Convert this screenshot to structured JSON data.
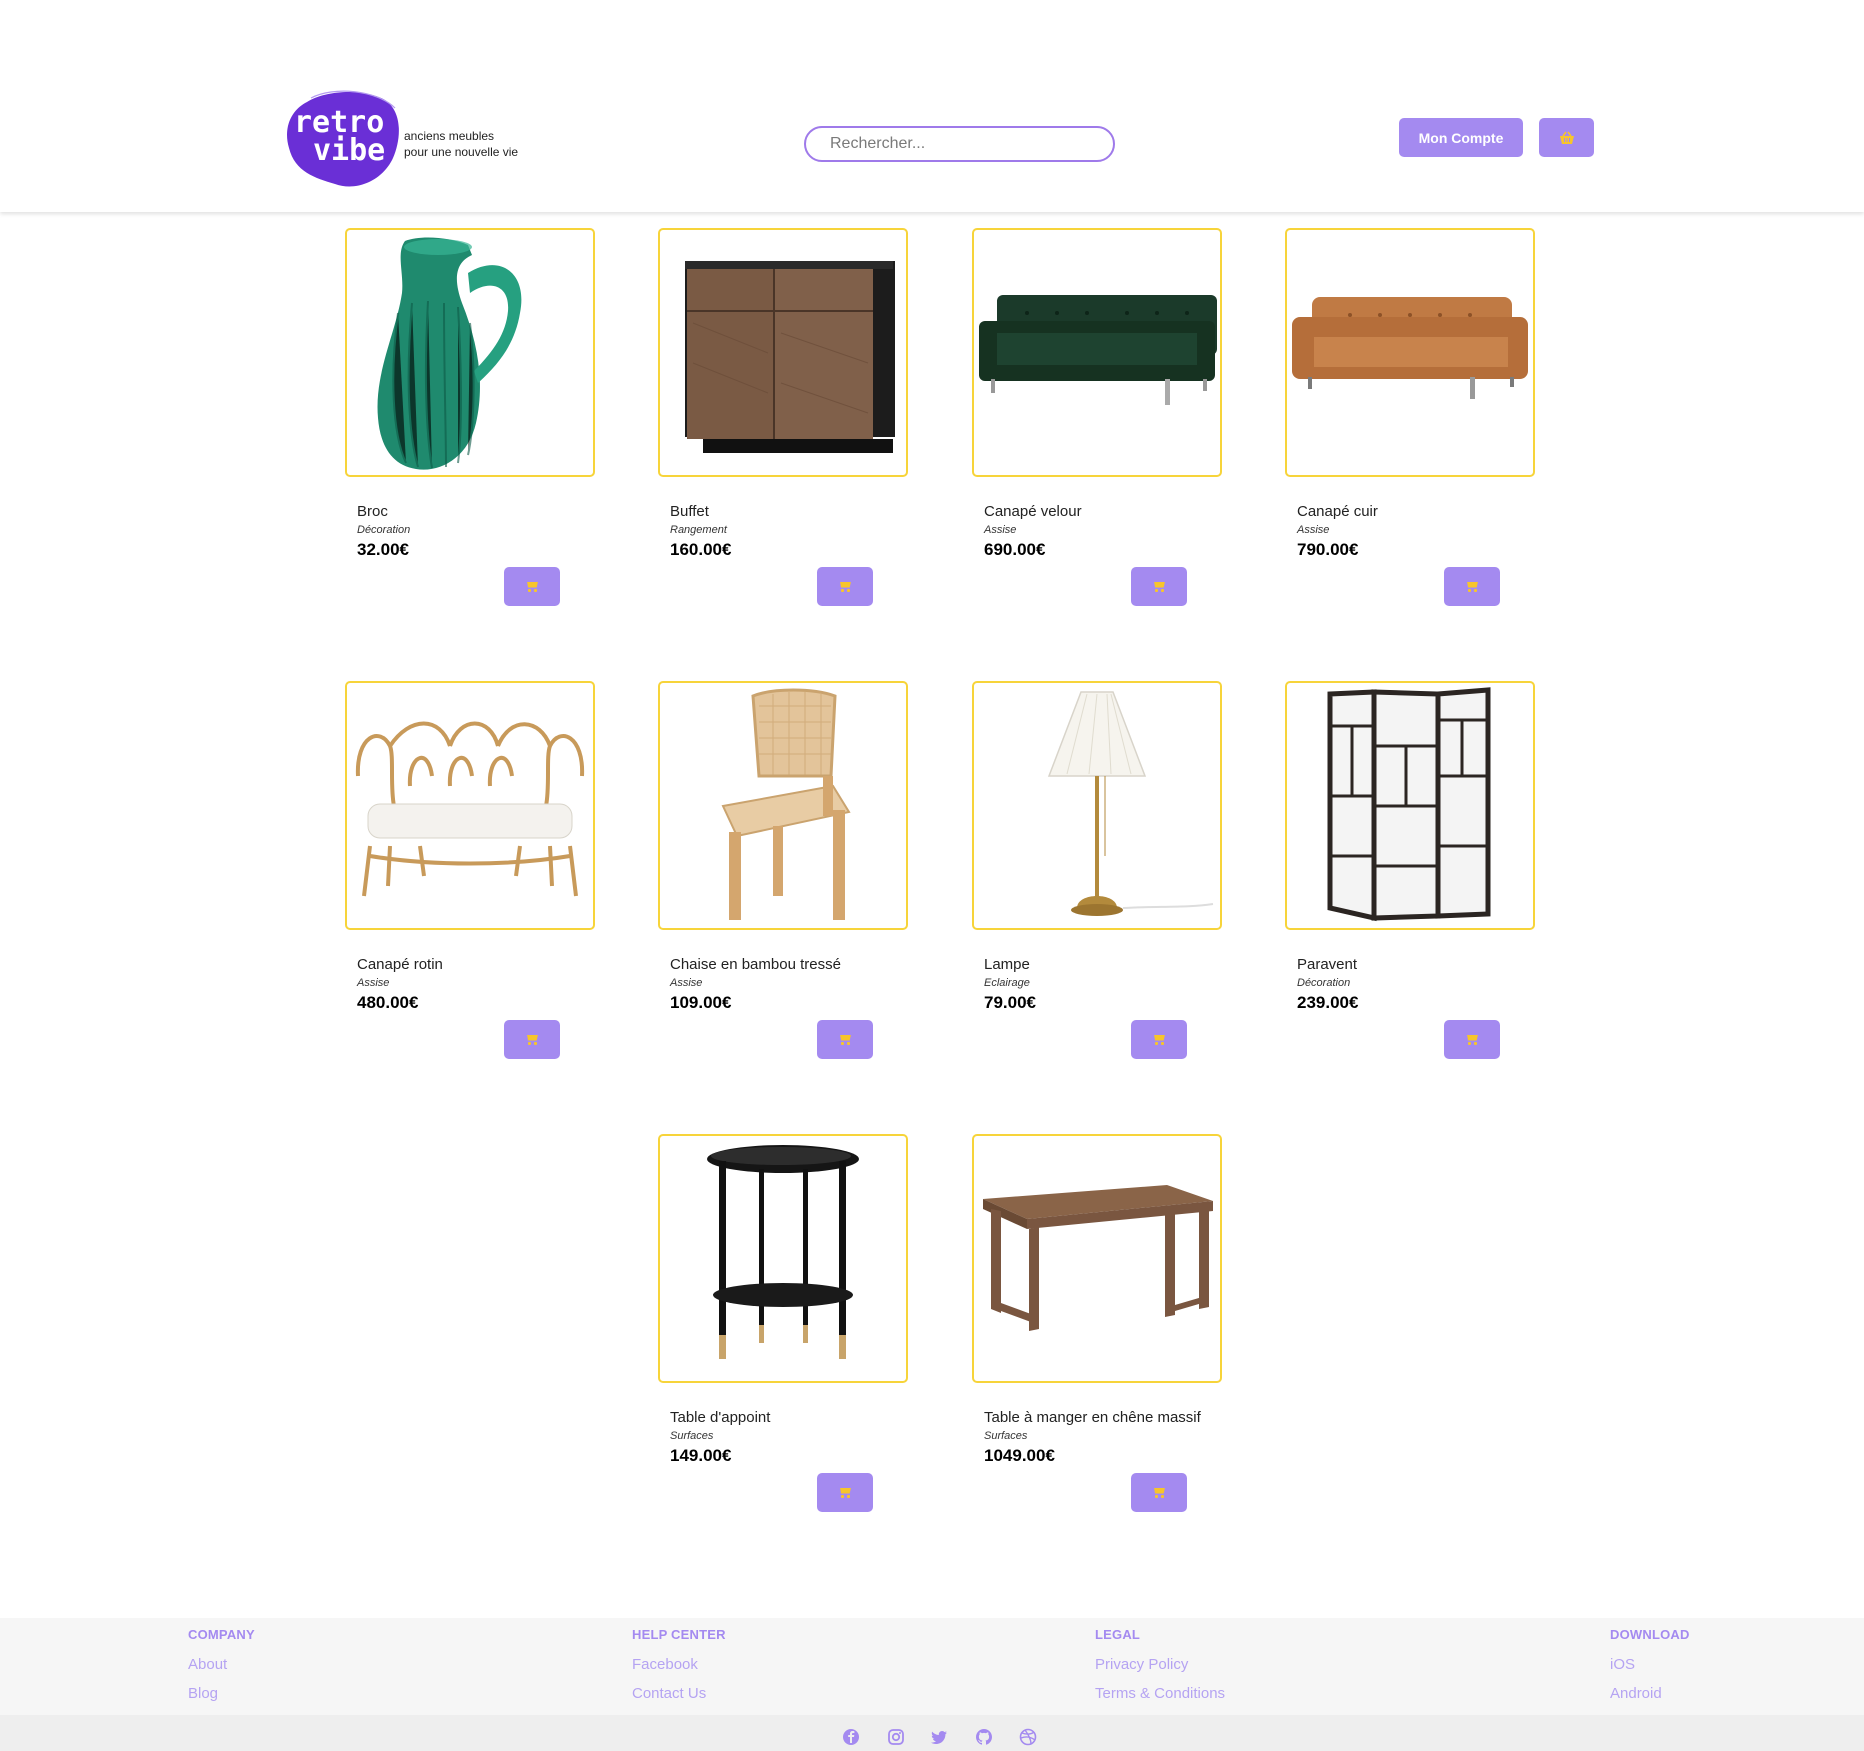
{
  "brand": {
    "logo_line1": "retro",
    "logo_line2": "vibe",
    "tagline_line1": "anciens meubles",
    "tagline_line2": "pour une nouvelle vie"
  },
  "search": {
    "placeholder": "Rechercher..."
  },
  "header": {
    "account_label": "Mon Compte",
    "basket_icon": "basket-icon"
  },
  "colors": {
    "accent": "#a48af0",
    "card_border": "#f7d43a",
    "cart_icon": "#f7c52b"
  },
  "products": [
    {
      "name": "Broc",
      "category": "Décoration",
      "price": "32.00€",
      "image": "green-glass-pitcher"
    },
    {
      "name": "Buffet",
      "category": "Rangement",
      "price": "160.00€",
      "image": "wooden-sideboard"
    },
    {
      "name": "Canapé velour",
      "category": "Assise",
      "price": "690.00€",
      "image": "green-velvet-sofa"
    },
    {
      "name": "Canapé cuir",
      "category": "Assise",
      "price": "790.00€",
      "image": "tan-leather-sofa"
    },
    {
      "name": "Canapé rotin",
      "category": "Assise",
      "price": "480.00€",
      "image": "rattan-loveseat"
    },
    {
      "name": "Chaise en bambou tressé",
      "category": "Assise",
      "price": "109.00€",
      "image": "woven-bamboo-chair"
    },
    {
      "name": "Lampe",
      "category": "Eclairage",
      "price": "79.00€",
      "image": "brass-table-lamp"
    },
    {
      "name": "Paravent",
      "category": "Décoration",
      "price": "239.00€",
      "image": "folding-screen"
    },
    {
      "name": "Table d'appoint",
      "category": "Surfaces",
      "price": "149.00€",
      "image": "black-side-table"
    },
    {
      "name": "Table à manger en chêne massif",
      "category": "Surfaces",
      "price": "1049.00€",
      "image": "oak-dining-table"
    }
  ],
  "footer": {
    "columns": [
      {
        "heading": "COMPANY",
        "links": [
          "About",
          "Blog"
        ]
      },
      {
        "heading": "HELP CENTER",
        "links": [
          "Facebook",
          "Contact Us"
        ]
      },
      {
        "heading": "LEGAL",
        "links": [
          "Privacy Policy",
          "Terms & Conditions"
        ]
      },
      {
        "heading": "DOWNLOAD",
        "links": [
          "iOS",
          "Android"
        ]
      }
    ],
    "social_icons": [
      "facebook-icon",
      "instagram-icon",
      "twitter-icon",
      "github-icon",
      "dribbble-icon"
    ]
  }
}
